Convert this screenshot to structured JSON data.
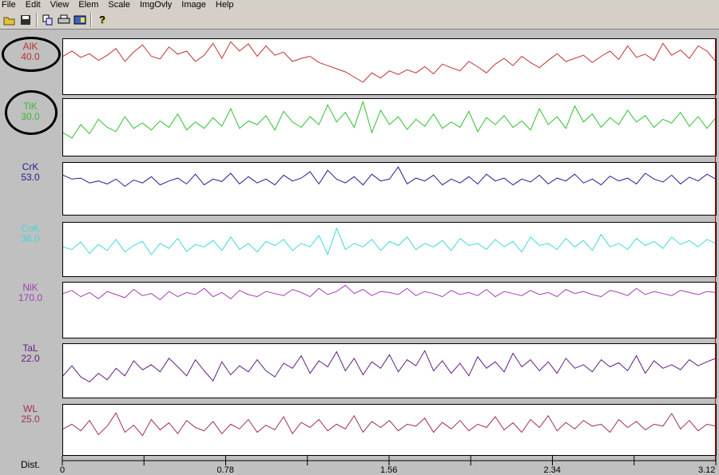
{
  "menu": [
    "File",
    "Edit",
    "View",
    "Elem",
    "Scale",
    "ImgOvly",
    "Image",
    "Help"
  ],
  "toolbar": [
    "open-icon",
    "save-icon",
    "copy-icon",
    "print-icon",
    "image-icon",
    "help-icon"
  ],
  "chart_data": {
    "type": "line",
    "xlabel": "Dist.",
    "xlim": [
      0,
      3.12
    ],
    "xticks": [
      "0",
      "0.78",
      "1.56",
      "2.34",
      "3.12"
    ],
    "ylim": [
      0,
      100
    ],
    "series": [
      {
        "name": "AlK",
        "scale": "40.0",
        "color": "#c03030",
        "values": [
          70,
          80,
          68,
          75,
          62,
          72,
          85,
          60,
          78,
          92,
          70,
          65,
          88,
          74,
          80,
          60,
          72,
          95,
          66,
          98,
          80,
          94,
          70,
          90,
          72,
          78,
          60,
          66,
          70,
          58,
          52,
          46,
          40,
          30,
          20,
          38,
          28,
          42,
          35,
          44,
          38,
          50,
          36,
          55,
          48,
          42,
          60,
          50,
          38,
          55,
          66,
          52,
          70,
          58,
          48,
          62,
          75,
          60,
          66,
          72,
          58,
          70,
          80,
          64,
          90,
          68,
          74,
          62,
          95,
          72,
          82,
          66,
          90,
          80,
          60
        ]
      },
      {
        "name": "TiK",
        "scale": "30.0",
        "color": "#30c030",
        "values": [
          40,
          30,
          55,
          38,
          65,
          50,
          42,
          70,
          48,
          58,
          45,
          62,
          50,
          75,
          45,
          60,
          48,
          68,
          52,
          85,
          48,
          62,
          55,
          72,
          45,
          80,
          60,
          50,
          70,
          55,
          92,
          60,
          78,
          50,
          98,
          40,
          82,
          55,
          70,
          46,
          65,
          52,
          75,
          48,
          60,
          50,
          80,
          42,
          68,
          55,
          72,
          50,
          62,
          45,
          85,
          55,
          70,
          48,
          90,
          60,
          75,
          50,
          68,
          55,
          82,
          60,
          72,
          50,
          65,
          58,
          78,
          52,
          70,
          48,
          68
        ]
      },
      {
        "name": "CrK",
        "scale": "53.0",
        "color": "#202090",
        "values": [
          78,
          70,
          72,
          62,
          66,
          60,
          70,
          55,
          68,
          62,
          75,
          58,
          66,
          72,
          60,
          80,
          58,
          70,
          65,
          82,
          60,
          75,
          62,
          70,
          58,
          78,
          66,
          72,
          85,
          60,
          88,
          70,
          62,
          75,
          58,
          80,
          66,
          70,
          95,
          60,
          72,
          66,
          78,
          58,
          70,
          62,
          75,
          60,
          80,
          66,
          72,
          58,
          70,
          64,
          78,
          60,
          72,
          66,
          80,
          62,
          70,
          58,
          76,
          66,
          72,
          60,
          82,
          70,
          64,
          78,
          60,
          74,
          66,
          80,
          70
        ]
      },
      {
        "name": "CoK",
        "scale": "36.0",
        "color": "#40d8d8",
        "values": [
          55,
          50,
          65,
          42,
          60,
          48,
          70,
          45,
          58,
          66,
          40,
          62,
          52,
          72,
          46,
          60,
          55,
          68,
          48,
          75,
          50,
          62,
          45,
          66,
          58,
          70,
          48,
          62,
          55,
          78,
          40,
          92,
          50,
          62,
          55,
          70,
          48,
          66,
          58,
          75,
          50,
          62,
          55,
          68,
          48,
          72,
          58,
          62,
          50,
          70,
          55,
          66,
          45,
          75,
          58,
          62,
          50,
          72,
          55,
          68,
          48,
          80,
          55,
          62,
          50,
          72,
          58,
          66,
          52,
          75,
          60,
          68,
          55,
          70,
          62
        ]
      },
      {
        "name": "NiK",
        "scale": "170.0",
        "color": "#a040b0",
        "values": [
          82,
          88,
          76,
          84,
          72,
          86,
          80,
          74,
          90,
          78,
          82,
          70,
          86,
          76,
          84,
          80,
          92,
          76,
          84,
          72,
          88,
          80,
          76,
          86,
          82,
          78,
          90,
          84,
          76,
          92,
          80,
          86,
          98,
          82,
          90,
          78,
          86,
          84,
          80,
          92,
          78,
          86,
          82,
          76,
          88,
          80,
          84,
          78,
          90,
          76,
          86,
          82,
          78,
          88,
          80,
          84,
          76,
          90,
          82,
          86,
          80,
          76,
          88,
          84,
          78,
          92,
          80,
          86,
          82,
          78,
          88,
          84,
          80,
          86,
          84
        ]
      },
      {
        "name": "TaL",
        "scale": "22.0",
        "color": "#602080",
        "values": [
          40,
          60,
          38,
          28,
          45,
          32,
          55,
          40,
          70,
          52,
          62,
          48,
          75,
          58,
          40,
          72,
          50,
          30,
          68,
          42,
          60,
          48,
          72,
          50,
          38,
          65,
          55,
          80,
          45,
          70,
          58,
          88,
          50,
          75,
          42,
          68,
          55,
          82,
          48,
          72,
          60,
          90,
          50,
          70,
          45,
          65,
          40,
          78,
          55,
          68,
          48,
          85,
          58,
          72,
          50,
          68,
          45,
          75,
          55,
          62,
          48,
          72,
          58,
          66,
          50,
          80,
          45,
          70,
          55,
          62,
          52,
          72,
          60,
          68,
          75
        ]
      },
      {
        "name": "WL",
        "scale": "25.0",
        "color": "#a03050",
        "values": [
          52,
          62,
          48,
          70,
          40,
          58,
          86,
          45,
          60,
          38,
          72,
          50,
          65,
          42,
          70,
          55,
          48,
          68,
          42,
          62,
          52,
          72,
          45,
          60,
          50,
          78,
          42,
          66,
          55,
          72,
          48,
          62,
          52,
          80,
          45,
          68,
          55,
          70,
          48,
          62,
          58,
          75,
          45,
          66,
          52,
          70,
          48,
          62,
          55,
          78,
          50,
          65,
          45,
          72,
          55,
          80,
          48,
          66,
          52,
          70,
          58,
          62,
          45,
          72,
          55,
          68,
          50,
          62,
          58,
          85,
          52,
          70,
          48,
          62,
          58
        ]
      }
    ]
  }
}
